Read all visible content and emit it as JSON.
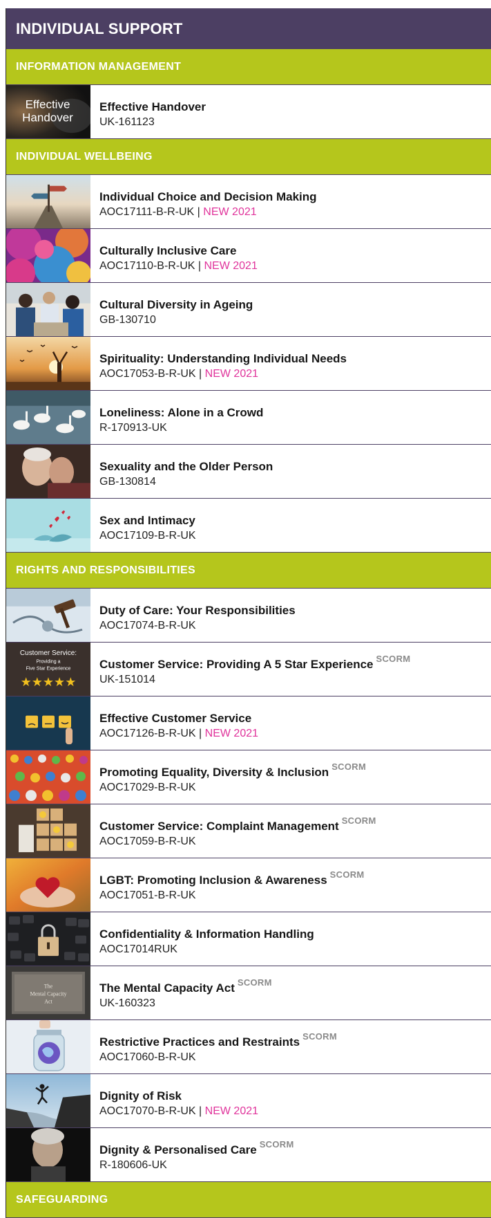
{
  "catalog": {
    "title": "INDIVIDUAL SUPPORT",
    "sections": [
      {
        "title": "INFORMATION MANAGEMENT",
        "courses": [
          {
            "title": "Effective Handover",
            "code": "UK-161123",
            "scorm": "",
            "badge": "",
            "sep": "",
            "thumb_icon": "effective-handover-thumbnail",
            "thumb_text_1": "Effective",
            "thumb_text_2": "Handover"
          }
        ]
      },
      {
        "title": "INDIVIDUAL WELLBEING",
        "courses": [
          {
            "title": "Individual Choice and Decision Making",
            "code": "AOC17111-B-R-UK",
            "sep": " | ",
            "badge": "NEW 2021",
            "scorm": "",
            "thumb_icon": "signpost-thumbnail"
          },
          {
            "title": "Culturally Inclusive Care",
            "code": "AOC17110-B-R-UK",
            "sep": " | ",
            "badge": "NEW 2021",
            "scorm": "",
            "thumb_icon": "colored-powder-hands-thumbnail"
          },
          {
            "title": "Cultural Diversity in Ageing",
            "code": "GB-130710",
            "sep": "",
            "badge": "",
            "scorm": "",
            "thumb_icon": "care-group-photo-thumbnail"
          },
          {
            "title": "Spirituality: Understanding Individual Needs",
            "code": "AOC17053-B-R-UK",
            "sep": " | ",
            "badge": "NEW 2021",
            "scorm": "",
            "thumb_icon": "sunset-silhouette-thumbnail"
          },
          {
            "title": "Loneliness: Alone in a Crowd",
            "code": "R-170913-UK",
            "sep": "",
            "badge": "",
            "scorm": "",
            "thumb_icon": "swans-thumbnail"
          },
          {
            "title": "Sexuality and the Older Person",
            "code": "GB-130814",
            "sep": "",
            "badge": "",
            "scorm": "",
            "thumb_icon": "older-couple-thumbnail"
          },
          {
            "title": "Sex and Intimacy",
            "code": "AOC17109-B-R-UK",
            "sep": "",
            "badge": "",
            "scorm": "",
            "thumb_icon": "birds-hearts-thumbnail"
          }
        ]
      },
      {
        "title": "RIGHTS AND RESPONSIBILITIES",
        "courses": [
          {
            "title": "Duty of Care: Your Responsibilities",
            "code": "AOC17074-B-R-UK",
            "sep": "",
            "badge": "",
            "scorm": "",
            "thumb_icon": "gavel-stethoscope-thumbnail"
          },
          {
            "title": "Customer Service: Providing A 5 Star Experience",
            "code": "UK-151014",
            "sep": "",
            "badge": "",
            "scorm": "SCORM",
            "thumb_icon": "five-stars-thumbnail",
            "thumb_text_1": "Customer Service:",
            "thumb_text_2": "Providing a",
            "thumb_text_3": "Five Star Experience",
            "thumb_stars": "★★★★★"
          },
          {
            "title": "Effective Customer Service",
            "code": "AOC17126-B-R-UK",
            "sep": " | ",
            "badge": "NEW 2021",
            "scorm": "",
            "thumb_icon": "smiley-feedback-thumbnail"
          },
          {
            "title": "Promoting Equality, Diversity & Inclusion",
            "code": "AOC17029-B-R-UK",
            "sep": "",
            "badge": "",
            "scorm": "SCORM",
            "thumb_icon": "colorful-figures-thumbnail"
          },
          {
            "title": "Customer Service: Complaint Management",
            "code": "AOC17059-B-R-UK",
            "sep": "",
            "badge": "",
            "scorm": "SCORM",
            "thumb_icon": "smiley-blocks-thumbnail"
          },
          {
            "title": "LGBT: Promoting Inclusion & Awareness",
            "code": "AOC17051-B-R-UK",
            "sep": "",
            "badge": "",
            "scorm": "SCORM",
            "thumb_icon": "hands-red-heart-thumbnail"
          },
          {
            "title": "Confidentiality & Information Handling",
            "code": "AOC17014RUK",
            "sep": "",
            "badge": "",
            "scorm": "",
            "thumb_icon": "keyboard-padlock-thumbnail"
          },
          {
            "title": "The Mental Capacity Act",
            "code": "UK-160323",
            "sep": "",
            "badge": "",
            "scorm": "SCORM",
            "thumb_icon": "stone-plaque-thumbnail",
            "thumb_text_1": "The",
            "thumb_text_2": "Mental Capacity",
            "thumb_text_3": "Act"
          },
          {
            "title": "Restrictive Practices and Restraints",
            "code": "AOC17060-B-R-UK",
            "sep": "",
            "badge": "",
            "scorm": "SCORM",
            "thumb_icon": "globe-in-jar-thumbnail"
          },
          {
            "title": "Dignity of Risk",
            "code": "AOC17070-B-R-UK",
            "sep": " | ",
            "badge": "NEW 2021",
            "scorm": "",
            "thumb_icon": "cliff-jump-thumbnail"
          },
          {
            "title": "Dignity & Personalised Care",
            "code": "R-180606-UK",
            "sep": "",
            "badge": "",
            "scorm": "SCORM",
            "thumb_icon": "elderly-woman-portrait-thumbnail"
          }
        ]
      },
      {
        "title": "SAFEGUARDING",
        "courses": []
      }
    ]
  },
  "colors": {
    "header_purple": "#4c3f63",
    "section_green": "#b5c61c",
    "new_badge_pink": "#e0339b",
    "scorm_gray": "#8a8a8a"
  }
}
